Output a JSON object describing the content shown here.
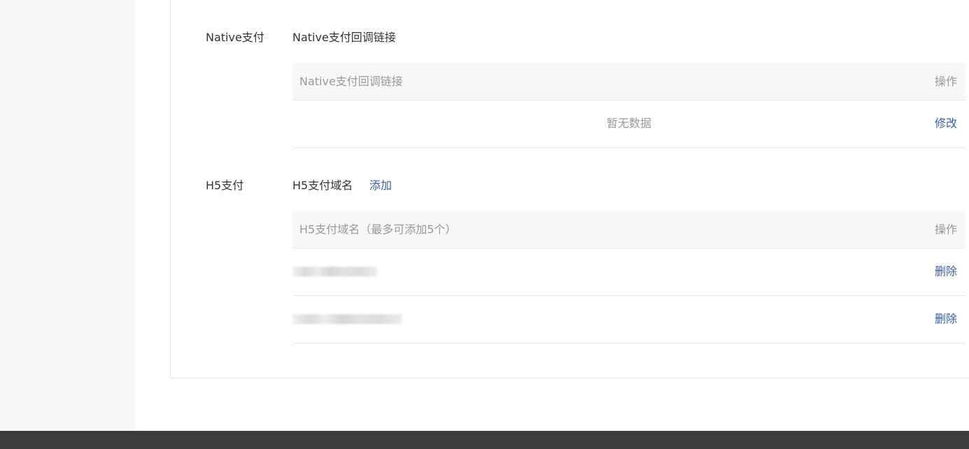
{
  "native_section": {
    "label": "Native支付",
    "sub_label": "Native支付回调链接",
    "table": {
      "col_main": "Native支付回调链接",
      "col_op": "操作",
      "empty_text": "暂无数据",
      "edit_label": "修改"
    }
  },
  "h5_section": {
    "label": "H5支付",
    "sub_label": "H5支付域名",
    "add_label": "添加",
    "table": {
      "col_main": "H5支付域名（最多可添加5个）",
      "col_op": "操作",
      "rows": [
        {
          "domain": "",
          "delete_label": "删除"
        },
        {
          "domain": "",
          "delete_label": "删除"
        }
      ]
    }
  }
}
